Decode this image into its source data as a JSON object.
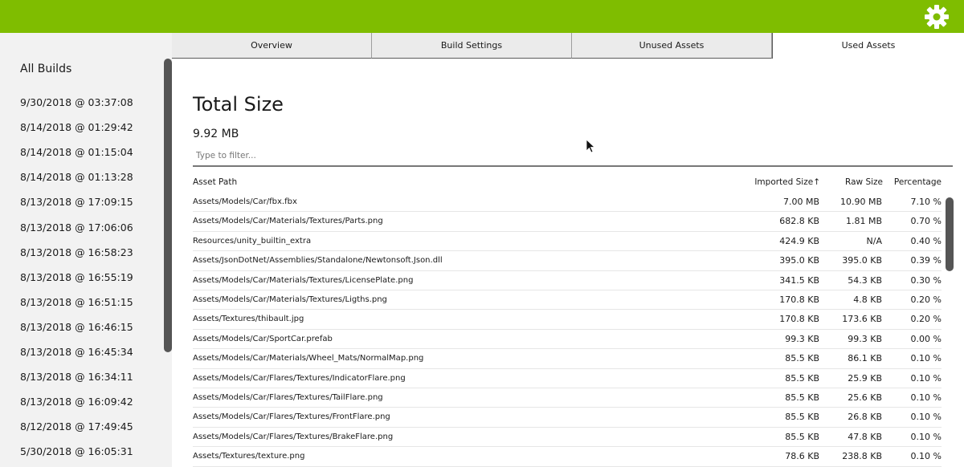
{
  "header": {
    "settings_icon": "gear-icon",
    "accent_color": "#7fbd00"
  },
  "sidebar": {
    "title": "All Builds",
    "builds": [
      "9/30/2018 @ 03:37:08",
      "8/14/2018 @ 01:29:42",
      "8/14/2018 @ 01:15:04",
      "8/14/2018 @ 01:13:28",
      "8/13/2018 @ 17:09:15",
      "8/13/2018 @ 17:06:06",
      "8/13/2018 @ 16:58:23",
      "8/13/2018 @ 16:55:19",
      "8/13/2018 @ 16:51:15",
      "8/13/2018 @ 16:46:15",
      "8/13/2018 @ 16:45:34",
      "8/13/2018 @ 16:34:11",
      "8/13/2018 @ 16:09:42",
      "8/12/2018 @ 17:49:45",
      "5/30/2018 @ 16:05:31"
    ]
  },
  "tabs": [
    {
      "label": "Overview",
      "active": false
    },
    {
      "label": "Build Settings",
      "active": false
    },
    {
      "label": "Unused Assets",
      "active": false
    },
    {
      "label": "Used Assets",
      "active": true
    }
  ],
  "main": {
    "title": "Total Size",
    "total_size": "9.92 MB",
    "filter_placeholder": "Type to filter...",
    "columns": {
      "path": "Asset Path",
      "imported": "Imported Size↑",
      "raw": "Raw Size",
      "percentage": "Percentage"
    },
    "rows": [
      {
        "path": "Assets/Models/Car/fbx.fbx",
        "imported": "7.00 MB",
        "raw": "10.90 MB",
        "pct": "7.10 %"
      },
      {
        "path": "Assets/Models/Car/Materials/Textures/Parts.png",
        "imported": "682.8 KB",
        "raw": "1.81 MB",
        "pct": "0.70 %"
      },
      {
        "path": "Resources/unity_builtin_extra",
        "imported": "424.9 KB",
        "raw": "N/A",
        "pct": "0.40 %"
      },
      {
        "path": "Assets/JsonDotNet/Assemblies/Standalone/Newtonsoft.Json.dll",
        "imported": "395.0 KB",
        "raw": "395.0 KB",
        "pct": "0.39 %"
      },
      {
        "path": "Assets/Models/Car/Materials/Textures/LicensePlate.png",
        "imported": "341.5 KB",
        "raw": "54.3 KB",
        "pct": "0.30 %"
      },
      {
        "path": "Assets/Models/Car/Materials/Textures/Ligths.png",
        "imported": "170.8 KB",
        "raw": "4.8 KB",
        "pct": "0.20 %"
      },
      {
        "path": "Assets/Textures/thibault.jpg",
        "imported": "170.8 KB",
        "raw": "173.6 KB",
        "pct": "0.20 %"
      },
      {
        "path": "Assets/Models/Car/SportCar.prefab",
        "imported": "99.3 KB",
        "raw": "99.3 KB",
        "pct": "0.00 %"
      },
      {
        "path": "Assets/Models/Car/Materials/Wheel_Mats/NormalMap.png",
        "imported": "85.5 KB",
        "raw": "86.1 KB",
        "pct": "0.10 %"
      },
      {
        "path": "Assets/Models/Car/Flares/Textures/IndicatorFlare.png",
        "imported": "85.5 KB",
        "raw": "25.9 KB",
        "pct": "0.10 %"
      },
      {
        "path": "Assets/Models/Car/Flares/Textures/TailFlare.png",
        "imported": "85.5 KB",
        "raw": "25.6 KB",
        "pct": "0.10 %"
      },
      {
        "path": "Assets/Models/Car/Flares/Textures/FrontFlare.png",
        "imported": "85.5 KB",
        "raw": "26.8 KB",
        "pct": "0.10 %"
      },
      {
        "path": "Assets/Models/Car/Flares/Textures/BrakeFlare.png",
        "imported": "85.5 KB",
        "raw": "47.8 KB",
        "pct": "0.10 %"
      },
      {
        "path": "Assets/Textures/texture.png",
        "imported": "78.6 KB",
        "raw": "238.8 KB",
        "pct": "0.10 %"
      }
    ]
  }
}
